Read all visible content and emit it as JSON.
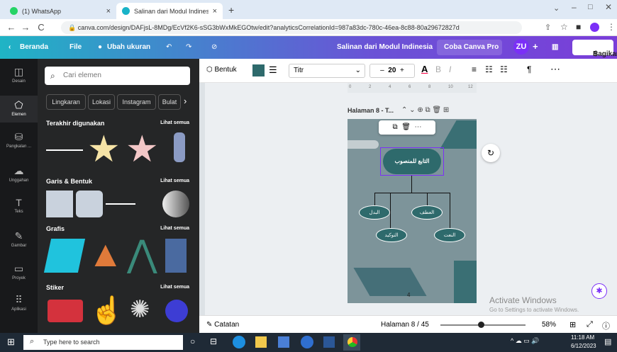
{
  "browser": {
    "tabs": [
      {
        "label": "(1) WhatsApp"
      },
      {
        "label": "Salinan dari Modul Indinesia - 12"
      }
    ],
    "url": "canva.com/design/DAFjsL-8MDg/EcVf2K6-sSG3bWxMkEGOtw/edit?analyticsCorrelationId=987a83dc-780c-46ea-8c88-80a29672827d"
  },
  "header": {
    "home": "Beranda",
    "file": "File",
    "resize": "Ubah ukuran",
    "doc_title": "Salinan dari Modul Indinesia",
    "pro": "Coba Canva Pro",
    "avatar": "ZU",
    "share": "Bagikan"
  },
  "rail": [
    {
      "label": "Desain",
      "icon": "layout-icon"
    },
    {
      "label": "Elemen",
      "icon": "shapes-icon"
    },
    {
      "label": "Pangkalan ...",
      "icon": "cloud-icon"
    },
    {
      "label": "Unggahan",
      "icon": "upload-icon"
    },
    {
      "label": "Teks",
      "icon": "text-icon"
    },
    {
      "label": "Gambar",
      "icon": "draw-icon"
    },
    {
      "label": "Proyek",
      "icon": "folder-icon"
    },
    {
      "label": "Aplikasi",
      "icon": "apps-icon"
    }
  ],
  "panel": {
    "search_placeholder": "Cari elemen",
    "chips": [
      "Lingkaran",
      "Lokasi",
      "Instagram",
      "Bulat"
    ],
    "sec_recent": "Terakhir digunakan",
    "sec_lines": "Garis & Bentuk",
    "sec_graphs": "Grafis",
    "sec_stickers": "Stiker",
    "see_all": "Lihat semua"
  },
  "toolbar": {
    "shape": "Bentuk",
    "font": "Titr",
    "size": "20"
  },
  "canvas": {
    "page_label": "Halaman 8 - T...",
    "ruler": [
      "0",
      "2",
      "4",
      "6",
      "8",
      "10",
      "12"
    ],
    "page_number": "4",
    "watermark": "Activate Windows",
    "watermark_sub": "Go to Settings to activate Windows.",
    "nodes": {
      "main": "التابع للمنصوب",
      "a": "البدل",
      "b": "العطف",
      "c": "التوكيد",
      "d": "النعت"
    }
  },
  "footer": {
    "notes": "Catatan",
    "page": "Halaman 8 / 45",
    "zoom": "58%"
  },
  "taskbar": {
    "search": "Type here to search",
    "time": "11:18 AM",
    "date": "6/12/2023"
  },
  "colors": {
    "teal": "#2e6a6c",
    "page": "#7d949a",
    "accent": "#7b2ff7"
  }
}
